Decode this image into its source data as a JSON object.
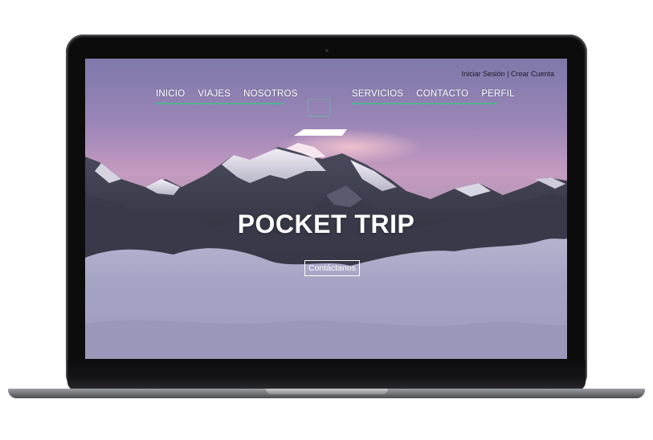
{
  "header": {
    "login_label": "Iniciar Sesión",
    "separator": " | ",
    "signup_label": "Crear Cuenta"
  },
  "nav": {
    "left": [
      "INICIO",
      "VIAJES",
      "NOSOTROS"
    ],
    "right": [
      "SERVICIOS",
      "CONTACTO",
      "PERFIL"
    ]
  },
  "hero": {
    "title": "POCKET TRIP",
    "cta_label": "Contáctanos"
  },
  "colors": {
    "accent_underline": "#4fb392",
    "nav_text": "#ffffff"
  }
}
